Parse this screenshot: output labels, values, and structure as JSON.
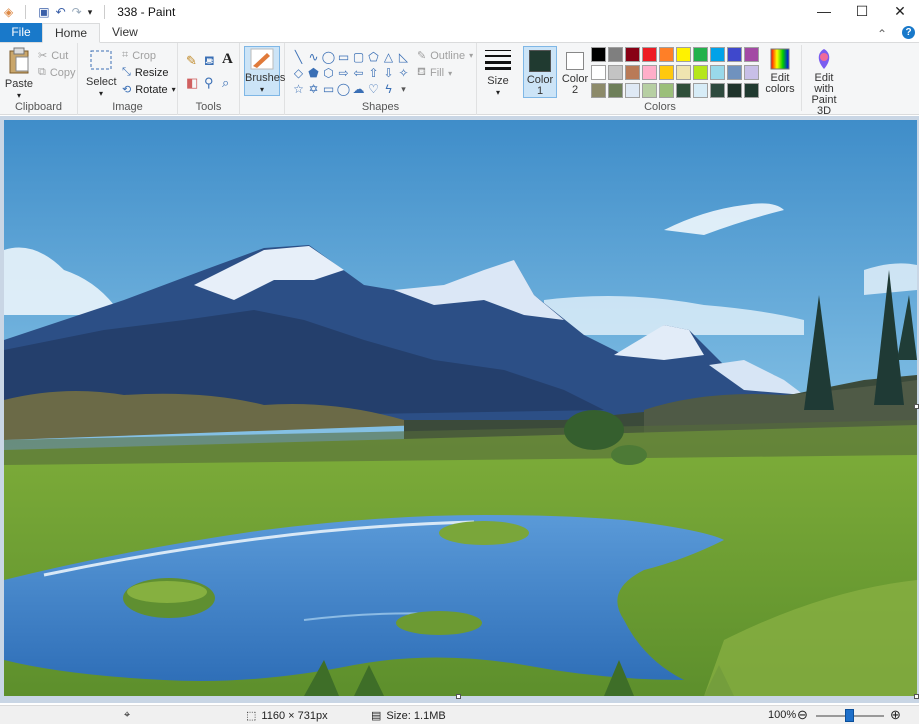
{
  "window": {
    "title": "338 - Paint",
    "minimize": "—",
    "maximize": "☐",
    "close": "✕"
  },
  "tabs": [
    {
      "label": "File"
    },
    {
      "label": "Home"
    },
    {
      "label": "View"
    }
  ],
  "ribbon": {
    "clipboard": {
      "group": "Clipboard",
      "paste": "Paste",
      "cut": "Cut",
      "copy": "Copy"
    },
    "image": {
      "group": "Image",
      "select": "Select",
      "crop": "Crop",
      "resize": "Resize",
      "rotate": "Rotate"
    },
    "tools": {
      "group": "Tools"
    },
    "brushes": {
      "label": "Brushes"
    },
    "shapes": {
      "group": "Shapes",
      "outline": "Outline",
      "fill": "Fill"
    },
    "size": {
      "label": "Size"
    },
    "colors": {
      "group": "Colors",
      "color1": "Color",
      "color1_num": "1",
      "color2": "Color",
      "color2_num": "2",
      "edit_colors_1": "Edit",
      "edit_colors_2": "colors",
      "paint3d_1": "Edit with",
      "paint3d_2": "Paint 3D",
      "color1_value": "#203a30",
      "color2_value": "#ffffff",
      "palette": [
        "#000000",
        "#7f7f7f",
        "#880015",
        "#ed1c24",
        "#ff7f27",
        "#fff200",
        "#22b14c",
        "#00a2e8",
        "#3f48cc",
        "#a349a4",
        "#ffffff",
        "#c3c3c3",
        "#b97a57",
        "#ffaec9",
        "#ffc90e",
        "#efe4b0",
        "#b5e61d",
        "#99d9ea",
        "#7092be",
        "#c8bfe7",
        "#8c8a6a",
        "#6e7f5a",
        "#dfe9f5",
        "#b7cfa3",
        "#9bbf7a",
        "#2f4f3a",
        "#d7ecf7",
        "#2e4a3e",
        "#1f332b",
        "#203a30"
      ]
    }
  },
  "status": {
    "dimensions": "1160 × 731px",
    "size": "Size: 1.1MB",
    "zoom": "100%"
  }
}
